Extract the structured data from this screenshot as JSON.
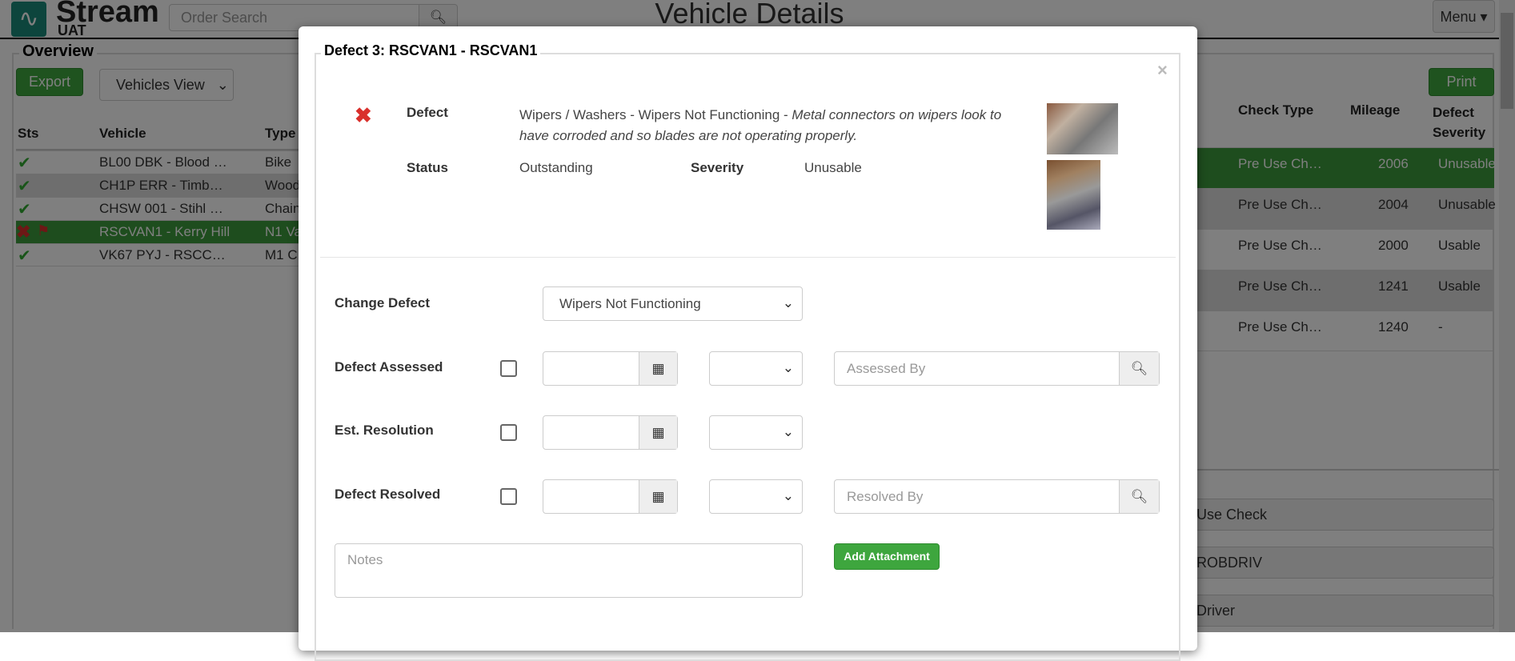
{
  "header": {
    "brand": "Stream",
    "brand_sub": "UAT",
    "search_placeholder": "Order Search",
    "title": "Vehicle Details",
    "menu_label": "Menu"
  },
  "overview": {
    "legend": "Overview",
    "export_label": "Export",
    "view_select": "Vehicles View",
    "print_label": "Print",
    "columns": [
      "Sts",
      "Vehicle",
      "Type"
    ],
    "rows": [
      {
        "status": "ok",
        "vehicle": "BL00 DBK - Blood …",
        "type": "Bike"
      },
      {
        "status": "ok",
        "vehicle": "CH1P ERR - Timb…",
        "type": "Wood"
      },
      {
        "status": "ok",
        "vehicle": "CHSW 001 - Stihl …",
        "type": "Chain"
      },
      {
        "status": "defect-flag",
        "vehicle": "RSCVAN1 - Kerry Hill",
        "type": "N1 Va"
      },
      {
        "status": "ok-warning",
        "vehicle": "VK67 PYJ - RSCC…",
        "type": "M1 C"
      }
    ]
  },
  "checks": {
    "columns": [
      "Check Type",
      "Mileage",
      "Defect Severity"
    ],
    "rows": [
      {
        "check_type": "Pre Use Ch…",
        "mileage": "2006",
        "severity": "Unusable"
      },
      {
        "check_type": "Pre Use Ch…",
        "mileage": "2004",
        "severity": "Unusable"
      },
      {
        "check_type": "Pre Use Ch…",
        "mileage": "2000",
        "severity": "Usable"
      },
      {
        "check_type": "Pre Use Ch…",
        "mileage": "1241",
        "severity": "Usable"
      },
      {
        "check_type": "Pre Use Ch…",
        "mileage": "1240",
        "severity": "-"
      }
    ],
    "details": [
      "Use Check",
      "ROBDRIV",
      "Driver"
    ]
  },
  "modal": {
    "title": "Defect 3: RSCVAN1 - RSCVAN1",
    "close": "×",
    "defect_label": "Defect",
    "defect_value": "Wipers / Washers - Wipers Not Functioning - ",
    "defect_note": "Metal connectors on wipers look to have corroded and so blades are not operating properly.",
    "status_label": "Status",
    "status_value": "Outstanding",
    "severity_label": "Severity",
    "severity_value": "Unusable",
    "change_defect_label": "Change Defect",
    "change_defect_value": "Wipers Not Functioning",
    "assessed_label": "Defect Assessed",
    "assessed_by_placeholder": "Assessed By",
    "est_resolution_label": "Est. Resolution",
    "resolved_label": "Defect Resolved",
    "resolved_by_placeholder": "Resolved By",
    "notes_placeholder": "Notes",
    "add_attachment_label": "Add Attachment"
  },
  "colors": {
    "green": "#3ea63e",
    "red": "#d9302c",
    "selected_row": "#3c9a3c"
  }
}
